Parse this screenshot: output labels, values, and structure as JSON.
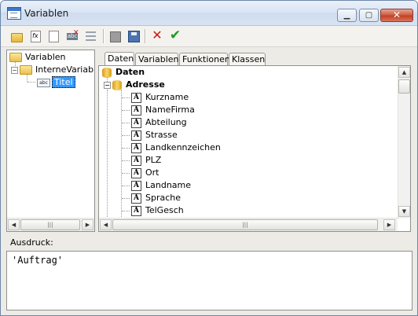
{
  "window": {
    "title": "Variablen"
  },
  "tree": {
    "root": "Variablen",
    "child": "InterneVariable",
    "leaf": "Titel"
  },
  "tabs": [
    "Daten",
    "Variablen",
    "Funktionen",
    "Klassen"
  ],
  "data_tree": {
    "root": "Daten",
    "group": "Adresse",
    "fields": [
      "Kurzname",
      "NameFirma",
      "Abteilung",
      "Strasse",
      "Landkennzeichen",
      "PLZ",
      "Ort",
      "Landname",
      "Sprache",
      "TelGesch"
    ]
  },
  "expression": {
    "label": "Ausdruck:",
    "value": "'Auftrag'"
  },
  "colors": {
    "delete": "#c81818",
    "confirm": "#1e9a1e",
    "selection": "#3399ff"
  }
}
